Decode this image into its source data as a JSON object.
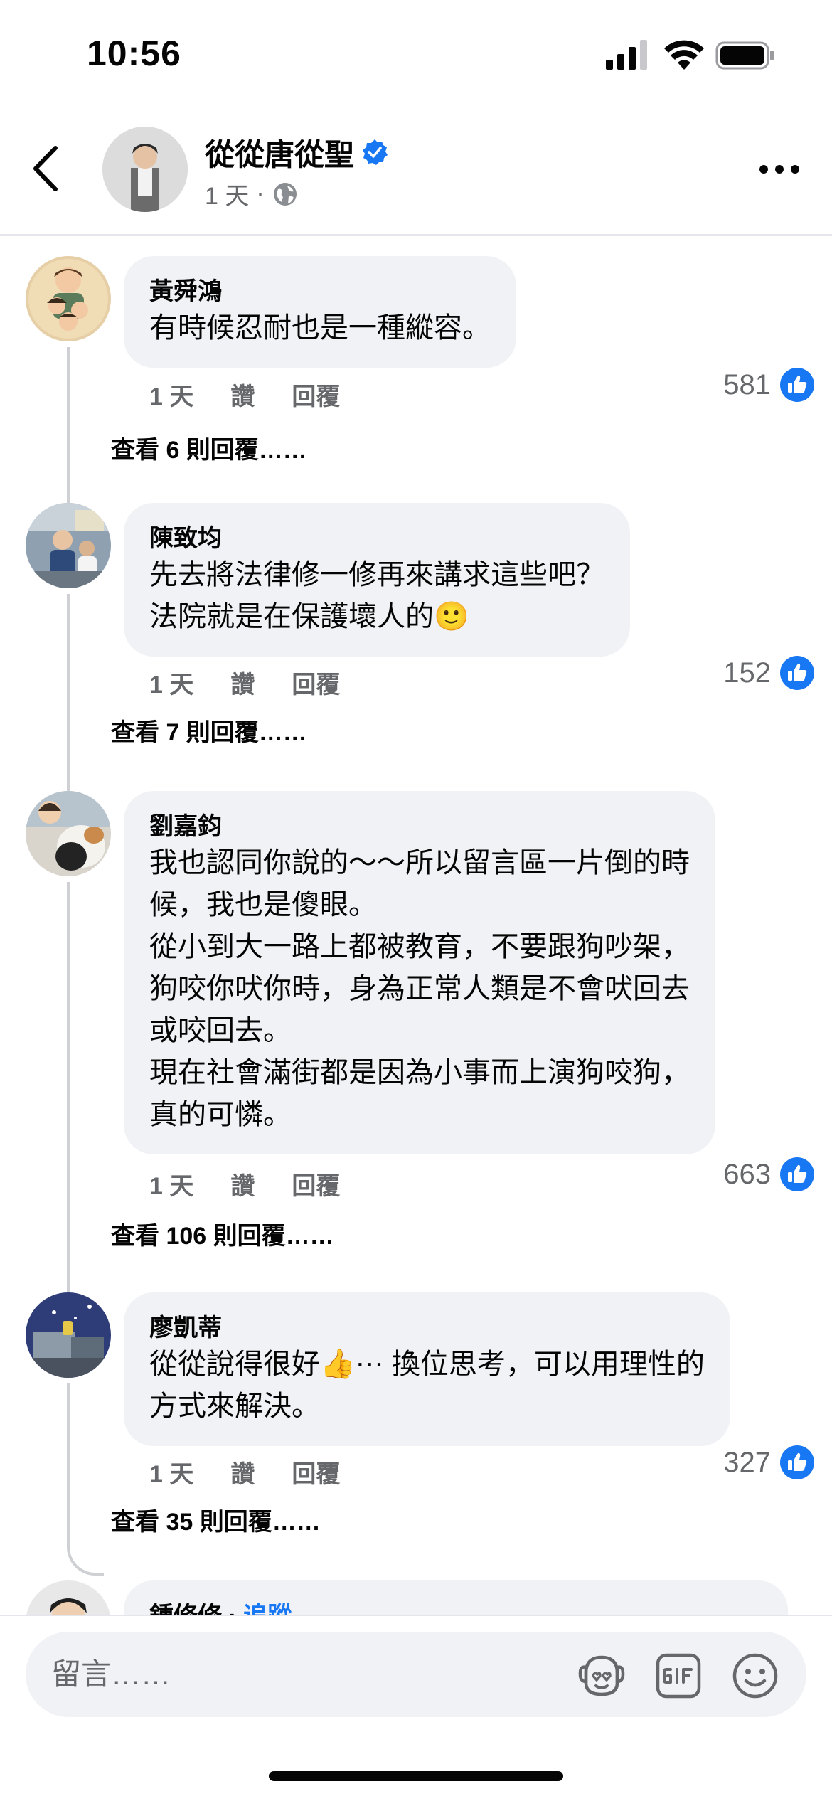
{
  "status_bar": {
    "time": "10:56"
  },
  "header": {
    "author": "從從唐從聖",
    "time": "1 天",
    "separator": "·"
  },
  "comments": [
    {
      "author": "黃舜鴻",
      "text": "有時候忍耐也是一種縱容。",
      "time": "1 天",
      "like_label": "讚",
      "reply_label": "回覆",
      "reactions": "581",
      "view_replies": "查看 6 則回覆……"
    },
    {
      "author": "陳致均",
      "text": "先去將法律修一修再來講求這些吧？\n法院就是在保護壞人的🙂",
      "time": "1 天",
      "like_label": "讚",
      "reply_label": "回覆",
      "reactions": "152",
      "view_replies": "查看 7 則回覆……"
    },
    {
      "author": "劉嘉鈞",
      "text": "我也認同你說的～～所以留言區一片倒的時\n候，我也是傻眼。\n從小到大一路上都被教育，不要跟狗吵架，\n狗咬你吠你時，身為正常人類是不會吠回去\n或咬回去。\n現在社會滿街都是因為小事而上演狗咬狗，\n真的可憐。",
      "time": "1 天",
      "like_label": "讚",
      "reply_label": "回覆",
      "reactions": "663",
      "view_replies": "查看 106 則回覆……"
    },
    {
      "author": "廖凱蒂",
      "text": "從從說得很好👍⋯ 換位思考，可以用理性的\n方式來解決。",
      "time": "1 天",
      "like_label": "讚",
      "reply_label": "回覆",
      "reactions": "327",
      "view_replies": "查看 35 則回覆……"
    },
    {
      "author": "鍾修修",
      "separator": " · ",
      "follow_label": "追蹤"
    }
  ],
  "composer": {
    "placeholder": "留言……"
  },
  "colors": {
    "accent": "#1877f2",
    "bubble": "#f0f2f5",
    "secondary_text": "#65676b"
  }
}
